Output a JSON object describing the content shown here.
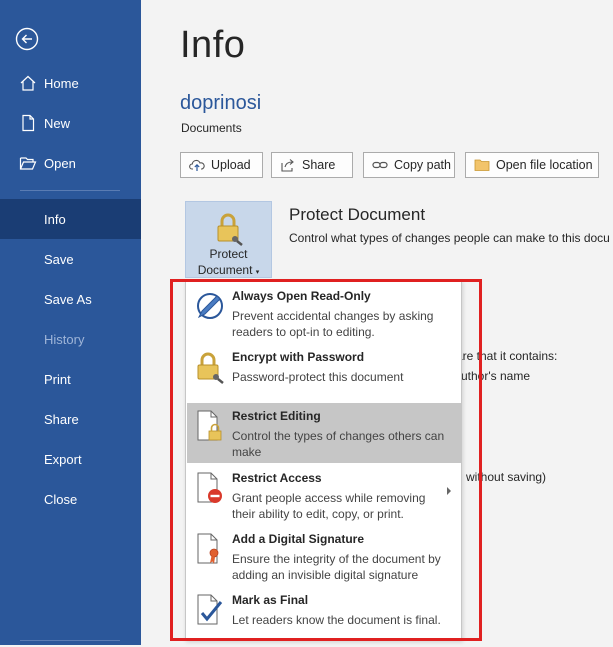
{
  "sidebar": {
    "back_icon": "back-arrow-icon",
    "items": [
      {
        "label": "Home",
        "icon": "home-icon"
      },
      {
        "label": "New",
        "icon": "new-document-icon"
      },
      {
        "label": "Open",
        "icon": "open-folder-icon"
      },
      {
        "label": "Info",
        "selected": true
      },
      {
        "label": "Save"
      },
      {
        "label": "Save As"
      },
      {
        "label": "History",
        "disabled": true
      },
      {
        "label": "Print"
      },
      {
        "label": "Share"
      },
      {
        "label": "Export"
      },
      {
        "label": "Close"
      }
    ]
  },
  "main": {
    "title": "Info",
    "doc_name": "doprinosi",
    "doc_location": "Documents",
    "buttons": {
      "upload": "Upload",
      "share": "Share",
      "copy_path": "Copy path",
      "open_location": "Open file location"
    },
    "protect": {
      "tile_line1": "Protect",
      "tile_line2": "Document",
      "title": "Protect Document",
      "description": "Control what types of changes people can make to this docu"
    },
    "background_fragments": {
      "inspect": "are that it contains:",
      "author": "uthor's name",
      "versions": "d without saving)"
    }
  },
  "dropdown": {
    "items": [
      {
        "title": "Always Open Read-Only",
        "desc": "Prevent accidental changes by asking readers to opt-in to editing.",
        "icon": "read-only-pencil-icon"
      },
      {
        "title": "Encrypt with Password",
        "desc": "Password-protect this document",
        "icon": "lock-key-icon"
      },
      {
        "title": "Restrict Editing",
        "desc": "Control the types of changes others can make",
        "icon": "restrict-editing-icon",
        "highlighted": true
      },
      {
        "title": "Restrict Access",
        "desc": "Grant people access while removing their ability to edit, copy, or print.",
        "icon": "restrict-access-icon",
        "has_submenu": true
      },
      {
        "title": "Add a Digital Signature",
        "desc": "Ensure the integrity of the document by adding an invisible digital signature",
        "icon": "digital-signature-icon"
      },
      {
        "title": "Mark as Final",
        "desc": "Let readers know the document is final.",
        "icon": "mark-final-icon"
      }
    ]
  },
  "colors": {
    "sidebar": "#2b579a",
    "sidebar_selected": "#1a3d74",
    "annotation_box": "#e02020",
    "highlight": "#c6c6c6"
  }
}
